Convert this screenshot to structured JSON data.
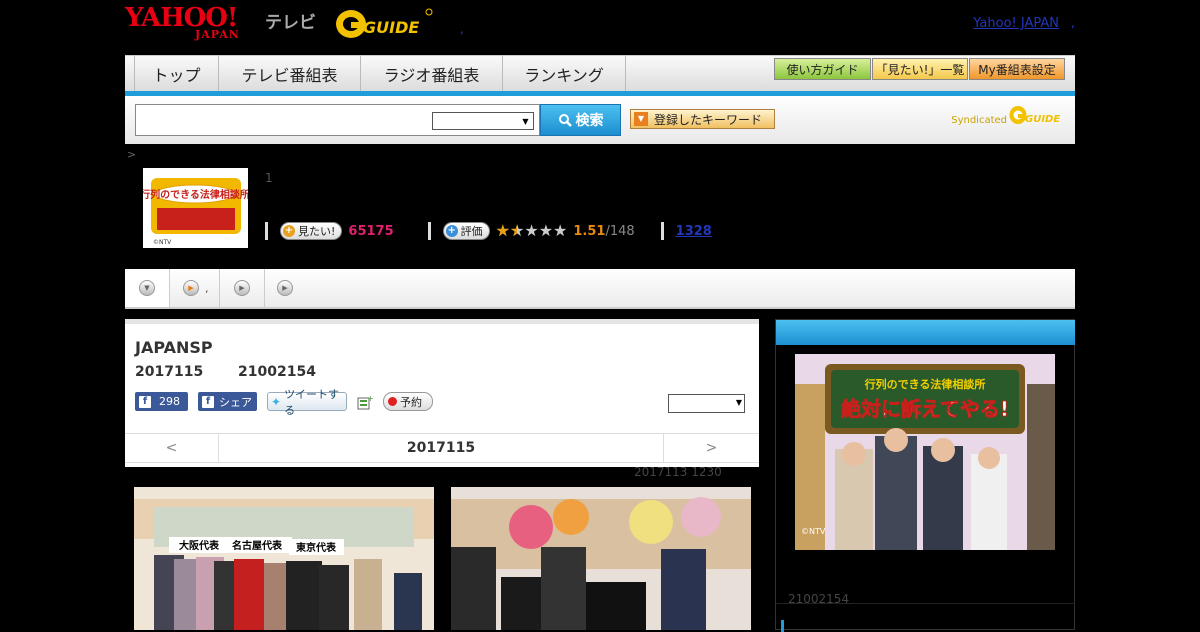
{
  "header": {
    "logo_yahoo": "YAHOO!",
    "logo_japan": "JAPAN",
    "logo_tv": "テレビ",
    "logo_g": "GUIDE",
    "dot": ",",
    "yahoo_link": "Yahoo! JAPAN",
    "dot2": ","
  },
  "nav": {
    "tabs": [
      "トップ",
      "テレビ番組表",
      "ラジオ番組表",
      "ランキング"
    ],
    "buttons": [
      "使い方ガイド",
      "「見たい!」一覧",
      "My番組表設定"
    ]
  },
  "search": {
    "button_label": "検索",
    "keyword_button": "登録したキーワード",
    "syndicated": "Syndicated",
    "syndicated_g": "GUIDE"
  },
  "breadcrumb": ">",
  "program": {
    "logo_text": "行列のできる法律相談所",
    "logo_copy": "©NTV",
    "num": "1",
    "mitai_label": "見たい!",
    "mitai_count": "65175",
    "rate_label": "評価",
    "rating": 1.51,
    "score": "1.51",
    "votes": "/148",
    "link_count": "1328"
  },
  "subnav": {
    "item2_label": ","
  },
  "main": {
    "title": "JAPANSP",
    "date": "2017115",
    "time": "21002154",
    "fb_like_count": "298",
    "fb_share": "シェア",
    "tweet": "ツイートする",
    "reserve": "予約",
    "datebar_prev": "<",
    "datebar_date": "2017115",
    "datebar_next": ">",
    "updated": "2017113  1230"
  },
  "photo1": {
    "labels": [
      "大阪代表",
      "名古屋代表",
      "東京代表"
    ]
  },
  "side": {
    "img_title": "行列のできる法律相談所",
    "img_sub": "絶対に訴えてやる!",
    "copy": "©NTV",
    "caption": "21002154"
  },
  "colors": {
    "accent_blue": "#1f9ddb",
    "pink": "#e2206f",
    "orange": "#e88a10",
    "link": "#2236b8"
  }
}
